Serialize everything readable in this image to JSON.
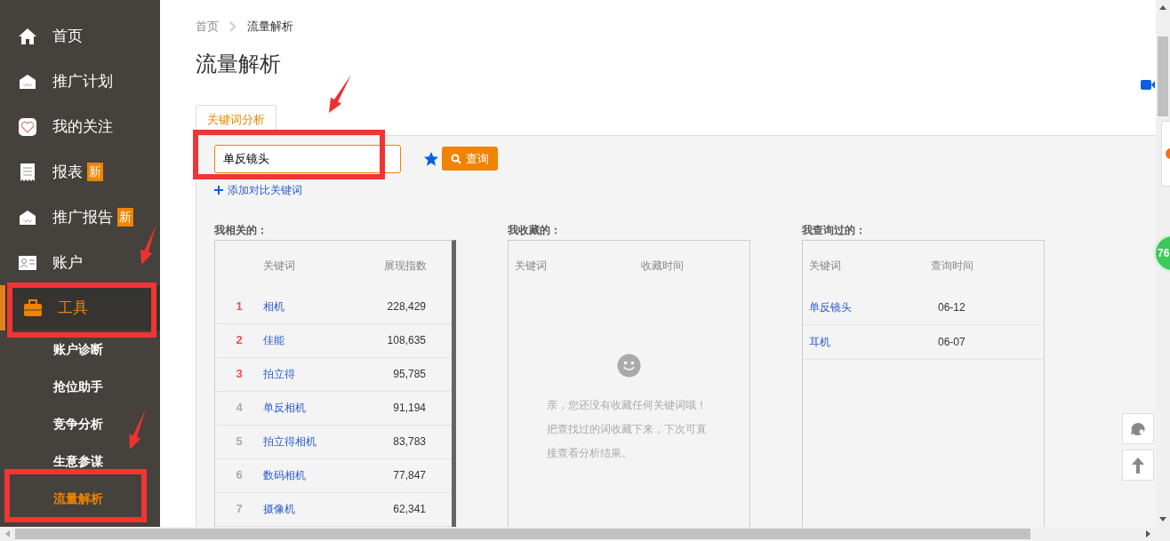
{
  "sidebar": {
    "items": [
      {
        "kind": "home",
        "label": "首页",
        "selected": false
      },
      {
        "kind": "plan",
        "label": "推广计划",
        "selected": false
      },
      {
        "kind": "heart",
        "label": "我的关注",
        "selected": false
      },
      {
        "kind": "report",
        "label": "报表",
        "badge": "新",
        "selected": false
      },
      {
        "kind": "plan",
        "label": "推广报告",
        "badge": "新",
        "selected": false
      },
      {
        "kind": "account",
        "label": "账户",
        "selected": false
      },
      {
        "kind": "toolbox",
        "label": "工具",
        "selected": true,
        "children": [
          {
            "label": "账户诊断",
            "selected": false
          },
          {
            "label": "抢位助手",
            "selected": false
          },
          {
            "label": "竞争分析",
            "selected": false
          },
          {
            "label": "生意参谋",
            "selected": false
          },
          {
            "label": "流量解析",
            "selected": true
          }
        ]
      }
    ]
  },
  "breadcrumb": [
    "首页",
    "流量解析"
  ],
  "title": "流量解析",
  "tabs": [
    {
      "label": "关键词分析",
      "selected": true
    }
  ],
  "search": {
    "value": "单反镜头",
    "button": "查询"
  },
  "add_link": "添加对比关键词",
  "related": {
    "heading": "我相关的：",
    "columns": [
      "关键词",
      "展现指数"
    ],
    "rows": [
      {
        "rank": "1",
        "keyword": "相机",
        "index": "228,429",
        "top": true
      },
      {
        "rank": "2",
        "keyword": "佳能",
        "index": "108,635",
        "top": true
      },
      {
        "rank": "3",
        "keyword": "拍立得",
        "index": "95,785",
        "top": true
      },
      {
        "rank": "4",
        "keyword": "单反相机",
        "index": "91,194",
        "top": false
      },
      {
        "rank": "5",
        "keyword": "拍立得相机",
        "index": "83,783",
        "top": false
      },
      {
        "rank": "6",
        "keyword": "数码相机",
        "index": "77,847",
        "top": false
      },
      {
        "rank": "7",
        "keyword": "摄像机",
        "index": "62,341",
        "top": false
      }
    ]
  },
  "favorites": {
    "heading": "我收藏的：",
    "columns": [
      "关键词",
      "收藏时间"
    ],
    "empty_lines": [
      "亲，您还没有收藏任何关键词哦！",
      "把查找过的词收藏下来，下次可直",
      "接查看分析结果。"
    ]
  },
  "history": {
    "heading": "我查询过的：",
    "columns": [
      "关键词",
      "查询时间"
    ],
    "rows": [
      {
        "keyword": "单反镜头",
        "time": "06-12"
      },
      {
        "keyword": "耳机",
        "time": "06-07"
      }
    ]
  },
  "floating_badge": "76"
}
